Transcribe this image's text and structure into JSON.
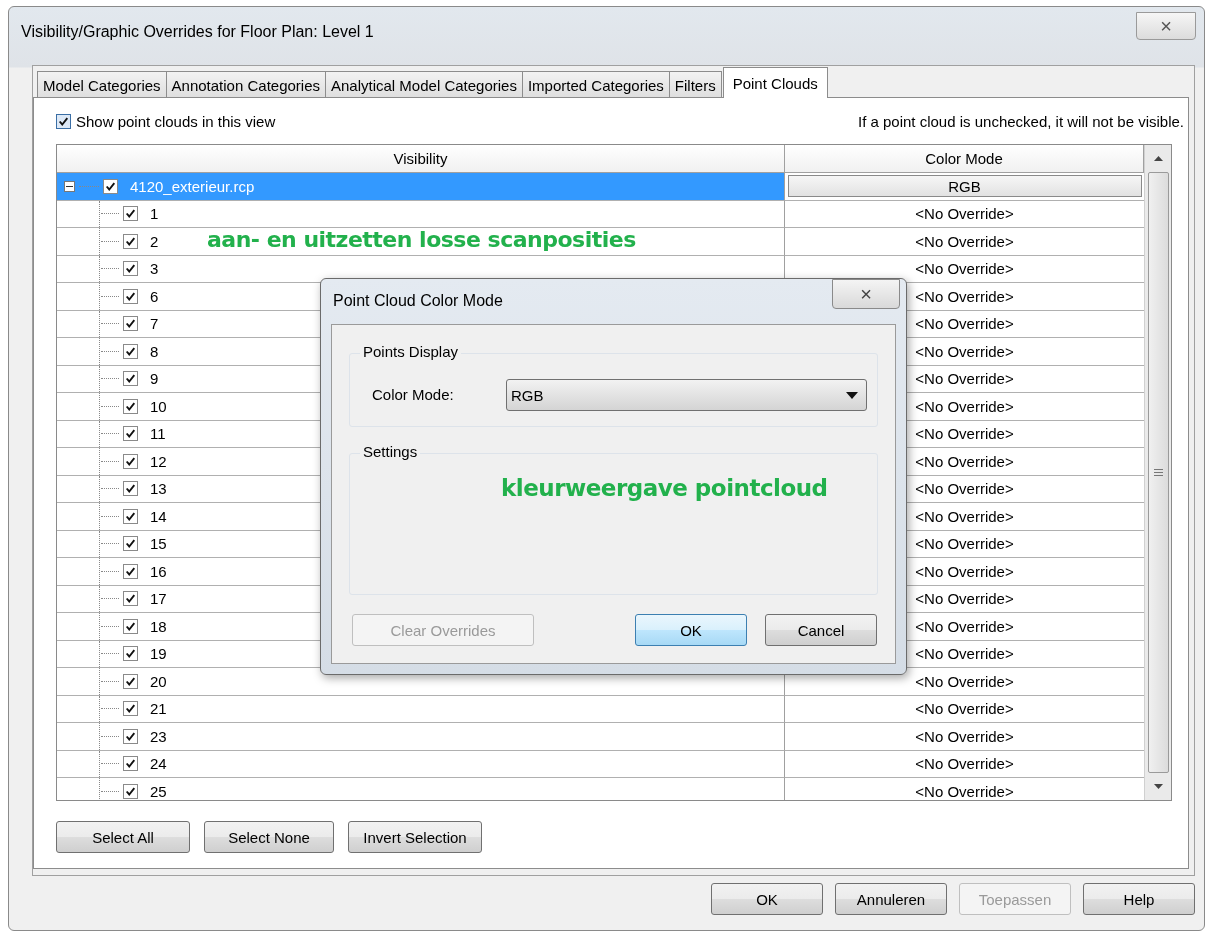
{
  "window": {
    "title": "Visibility/Graphic Overrides for Floor Plan: Level 1",
    "close": "×"
  },
  "tabs": [
    {
      "label": "Model Categories",
      "selected": false
    },
    {
      "label": "Annotation Categories",
      "selected": false
    },
    {
      "label": "Analytical Model Categories",
      "selected": false
    },
    {
      "label": "Imported Categories",
      "selected": false
    },
    {
      "label": "Filters",
      "selected": false
    },
    {
      "label": "Point Clouds",
      "selected": true
    }
  ],
  "show_option": {
    "label": "Show point clouds in this view",
    "checked": true
  },
  "hint": "If a point cloud is unchecked, it will not be visible.",
  "table": {
    "columns": [
      "Visibility",
      "Color Mode"
    ],
    "rows": [
      {
        "label": "4120_exterieur.rcp",
        "checked": true,
        "selected": true,
        "expanded": true,
        "color_mode": "RGB",
        "children": [
          {
            "label": "1",
            "checked": true,
            "color_mode": "<No Override>"
          },
          {
            "label": "2",
            "checked": true,
            "color_mode": "<No Override>"
          },
          {
            "label": "3",
            "checked": true,
            "color_mode": "<No Override>"
          },
          {
            "label": "6",
            "checked": true,
            "color_mode": "<No Override>"
          },
          {
            "label": "7",
            "checked": true,
            "color_mode": "<No Override>"
          },
          {
            "label": "8",
            "checked": true,
            "color_mode": "<No Override>"
          },
          {
            "label": "9",
            "checked": true,
            "color_mode": "<No Override>"
          },
          {
            "label": "10",
            "checked": true,
            "color_mode": "<No Override>"
          },
          {
            "label": "11",
            "checked": true,
            "color_mode": "<No Override>"
          },
          {
            "label": "12",
            "checked": true,
            "color_mode": "<No Override>"
          },
          {
            "label": "13",
            "checked": true,
            "color_mode": "<No Override>"
          },
          {
            "label": "14",
            "checked": true,
            "color_mode": "<No Override>"
          },
          {
            "label": "15",
            "checked": true,
            "color_mode": "<No Override>"
          },
          {
            "label": "16",
            "checked": true,
            "color_mode": "<No Override>"
          },
          {
            "label": "17",
            "checked": true,
            "color_mode": "<No Override>"
          },
          {
            "label": "18",
            "checked": true,
            "color_mode": "<No Override>"
          },
          {
            "label": "19",
            "checked": true,
            "color_mode": "<No Override>"
          },
          {
            "label": "20",
            "checked": true,
            "color_mode": "<No Override>"
          },
          {
            "label": "21",
            "checked": true,
            "color_mode": "<No Override>"
          },
          {
            "label": "23",
            "checked": true,
            "color_mode": "<No Override>"
          },
          {
            "label": "24",
            "checked": true,
            "color_mode": "<No Override>"
          },
          {
            "label": "25",
            "checked": true,
            "color_mode": "<No Override>"
          }
        ]
      }
    ]
  },
  "selection_buttons": [
    {
      "label": "Select All",
      "disabled": false
    },
    {
      "label": "Select None",
      "disabled": false
    },
    {
      "label": "Invert Selection",
      "disabled": false
    }
  ],
  "footer_buttons": [
    {
      "label": "OK",
      "disabled": false
    },
    {
      "label": "Annuleren",
      "disabled": false
    },
    {
      "label": "Toepassen",
      "disabled": true
    },
    {
      "label": "Help",
      "disabled": false
    }
  ],
  "annotations": [
    "aan- en uitzetten losse scanposities",
    "kleurweergave pointcloud"
  ],
  "color_dialog": {
    "title": "Point Cloud Color Mode",
    "close": "×",
    "points_display": {
      "legend": "Points Display",
      "field_label": "Color Mode:",
      "value": "RGB"
    },
    "settings": {
      "legend": "Settings"
    },
    "buttons": [
      {
        "label": "Clear Overrides",
        "disabled": true,
        "default": false
      },
      {
        "label": "OK",
        "disabled": false,
        "default": true
      },
      {
        "label": "Cancel",
        "disabled": false,
        "default": false
      }
    ]
  }
}
